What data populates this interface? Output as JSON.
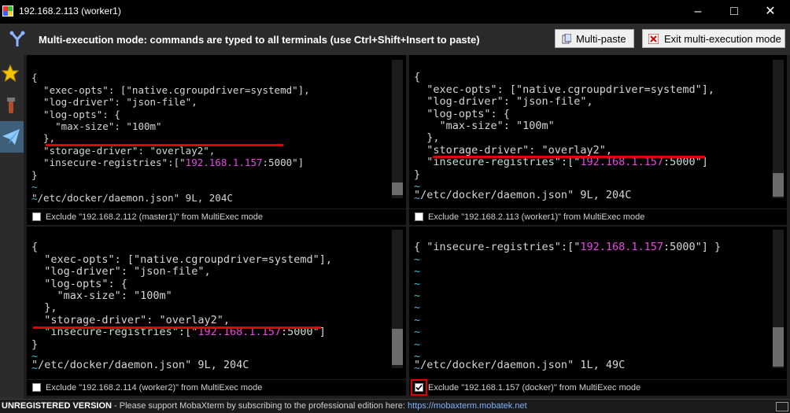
{
  "window": {
    "title": "192.168.2.113 (worker1)"
  },
  "banner": {
    "text": "Multi-execution mode: commands are typed to all terminals (use Ctrl+Shift+Insert to paste)",
    "multipaste_label": "Multi-paste",
    "exit_label": "Exit multi-execution mode"
  },
  "panes": [
    {
      "lines": [
        "{",
        "  \"exec-opts\": [\"native.cgroupdriver=systemd\"],",
        "  \"log-driver\": \"json-file\",",
        "  \"log-opts\": {",
        "    \"max-size\": \"100m\"",
        "  },",
        "  \"storage-driver\": \"overlay2\","
      ],
      "reg_key": "  \"insecure-registries\":[\"",
      "reg_ip": "192.168.1.157",
      "reg_tail": ":5000\"]",
      "close": "}",
      "status": "\"/etc/docker/daemon.json\" 9L, 204C",
      "exclude_label": "Exclude \"192.168.2.112 (master1)\" from MultiExec mode"
    },
    {
      "lines": [
        "{",
        "  \"exec-opts\": [\"native.cgroupdriver=systemd\"],",
        "  \"log-driver\": \"json-file\",",
        "  \"log-opts\": {",
        "    \"max-size\": \"100m\"",
        "  },",
        "  \"storage-driver\": \"overlay2\","
      ],
      "reg_key": "  \"insecure-registries\":[\"",
      "reg_ip": "192.168.1.157",
      "reg_tail": ":5000\"]",
      "close": "}",
      "status": "\"/etc/docker/daemon.json\" 9L, 204C",
      "exclude_label": "Exclude \"192.168.2.113 (worker1)\" from MultiExec mode"
    },
    {
      "lines": [
        "{",
        "  \"exec-opts\": [\"native.cgroupdriver=systemd\"],",
        "  \"log-driver\": \"json-file\",",
        "  \"log-opts\": {",
        "    \"max-size\": \"100m\"",
        "  },",
        "  \"storage-driver\": \"overlay2\","
      ],
      "reg_key": "  \"insecure-registries\":[\"",
      "reg_ip": "192.168.1.157",
      "reg_tail": ":5000\"]",
      "close": "}",
      "status": "\"/etc/docker/daemon.json\" 9L, 204C",
      "exclude_label": "Exclude \"192.168.2.114 (worker2)\" from MultiExec mode"
    },
    {
      "line_pre": "{ \"insecure-registries\":[\"",
      "reg_ip": "192.168.1.157",
      "line_post": ":5000\"] }",
      "status": "\"/etc/docker/daemon.json\" 1L, 49C",
      "exclude_label": "Exclude \"192.168.1.157 (docker)\" from MultiExec mode",
      "checked": true
    }
  ],
  "statusbar": {
    "unregistered": "UNREGISTERED VERSION",
    "message": "  -  Please support MobaXterm by subscribing to the professional edition here:  ",
    "link": "https://mobaxterm.mobatek.net"
  },
  "colors": {
    "accent_red": "#e00000",
    "ip_magenta": "#e648e6",
    "tilde_cyan": "#4db8c7"
  }
}
